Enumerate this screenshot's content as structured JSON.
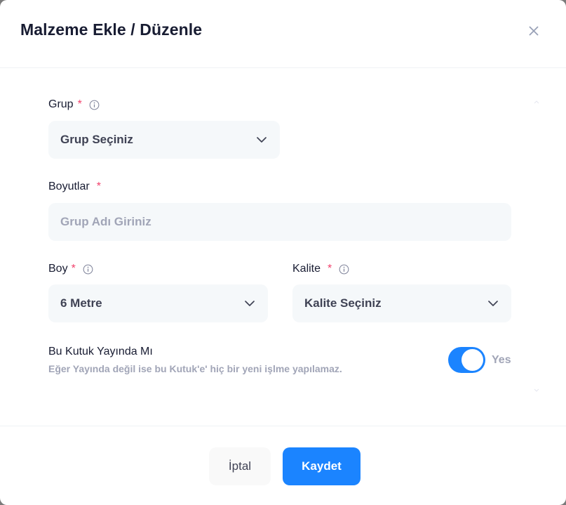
{
  "modal": {
    "title": "Malzeme Ekle / Düzenle",
    "close_icon": "close-icon"
  },
  "form": {
    "group": {
      "label": "Grup",
      "required_mark": "*",
      "info_icon": "info-icon",
      "selected": "Grup Seçiniz"
    },
    "dimensions": {
      "label": "Boyutlar",
      "required_mark": "*",
      "placeholder": "Grup Adı Giriniz",
      "value": ""
    },
    "length": {
      "label": "Boy",
      "required_mark": "*",
      "info_icon": "info-icon",
      "selected": "6 Metre"
    },
    "quality": {
      "label": "Kalite",
      "required_mark": "*",
      "info_icon": "info-icon",
      "selected": "Kalite Seçiniz"
    },
    "published": {
      "title": "Bu Kutuk Yayında Mı",
      "description": "Eğer Yayında değil ise bu Kutuk'e' hiç bir yeni işlme yapılamaz.",
      "state_label": "Yes",
      "checked": true
    }
  },
  "footer": {
    "cancel_label": "İptal",
    "save_label": "Kaydet"
  },
  "colors": {
    "primary": "#1b84ff",
    "required": "#f1416c",
    "input_bg": "#f5f8fa",
    "muted_text": "#a1a5b7"
  }
}
